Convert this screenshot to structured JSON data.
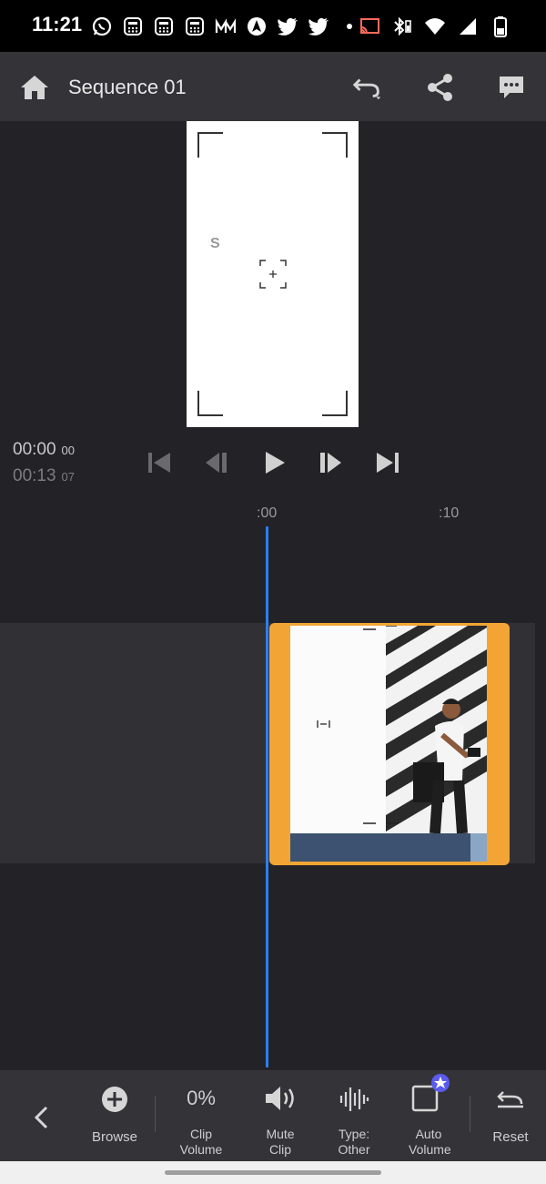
{
  "status": {
    "time": "11:21"
  },
  "header": {
    "title": "Sequence 01"
  },
  "preview": {
    "letter": "S"
  },
  "playback": {
    "current_time": "00:00",
    "current_frames": "00",
    "total_time": "00:13",
    "total_frames": "07"
  },
  "ruler": {
    "ticks": [
      ":00",
      ":10"
    ]
  },
  "toolbar": {
    "browse_label": "Browse",
    "clip_volume_value": "0%",
    "clip_volume_label": "Clip Volume",
    "mute_clip_label": "Mute Clip",
    "type_label": "Type: Other",
    "auto_volume_label": "Auto Volume",
    "reset_label": "Reset"
  },
  "colors": {
    "accent_playhead": "#2d7ff0",
    "clip_border": "#f2a535",
    "audio_track": "#3d5271",
    "premium_badge": "#5b5bf0"
  }
}
